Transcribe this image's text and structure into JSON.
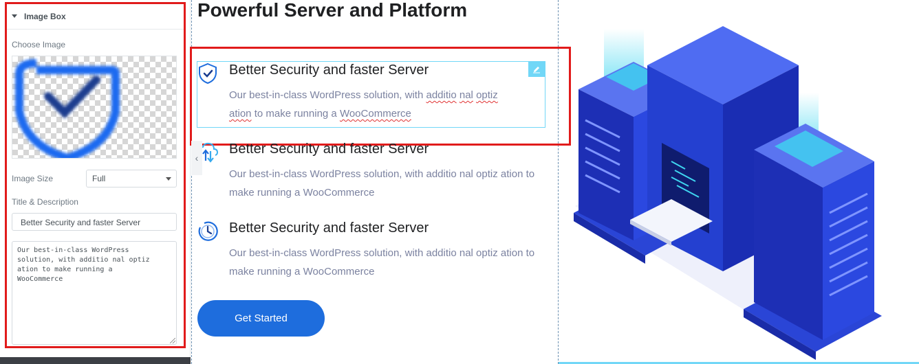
{
  "panel": {
    "section_title": "Image Box",
    "choose_image_label": "Choose Image",
    "image_size_label": "Image Size",
    "image_size_value": "Full",
    "title_desc_label": "Title & Description",
    "title_value": "Better Security and faster Server",
    "description_value": "Our best-in-class WordPress\nsolution, with additio nal optiz\nation to make running a\nWooCommerce"
  },
  "canvas": {
    "heading": "Powerful Server and Platform",
    "features": [
      {
        "icon": "shield-check-icon",
        "title": "Better Security and faster Server",
        "desc_line1_parts": [
          "Our best-in-class WordPress solution, with ",
          "additio",
          " ",
          "nal",
          " ",
          "optiz"
        ],
        "desc_line2_parts": [
          "ation",
          " to make running a ",
          "WooCommerce"
        ]
      },
      {
        "icon": "cloud-transfer-icon",
        "title": "Better Security and faster Server",
        "desc": "Our best-in-class WordPress solution, with additio nal optiz ation to make running a WooCommerce"
      },
      {
        "icon": "clock-icon",
        "title": "Better Security and faster Server",
        "desc": "Our best-in-class WordPress solution, with additio nal optiz ation to make running a WooCommerce"
      }
    ],
    "cta_label": "Get Started",
    "illustration": "server-illustration"
  },
  "colors": {
    "accent": "#1e6ddd",
    "selection": "#71d7f7",
    "highlight": "#e11b1b",
    "desc_text": "#7b82a0"
  }
}
